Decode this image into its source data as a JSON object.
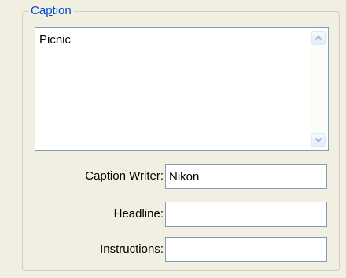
{
  "group": {
    "title_prefix": "Ca",
    "title_accel": "p",
    "title_suffix": "tion"
  },
  "caption": {
    "value": "Picnic",
    "scroll_up_icon": "arrow-up-icon",
    "scroll_down_icon": "arrow-down-icon"
  },
  "fields": {
    "caption_writer": {
      "label": "Caption Writer:",
      "value": "Nikon"
    },
    "headline": {
      "label": "Headline:",
      "value": ""
    },
    "instructions": {
      "label": "Instructions:",
      "value": ""
    }
  },
  "colors": {
    "legend": "#0046d5",
    "panel": "#f1efe2",
    "input_border": "#7f9db9",
    "arrow": "#aab8d6"
  }
}
